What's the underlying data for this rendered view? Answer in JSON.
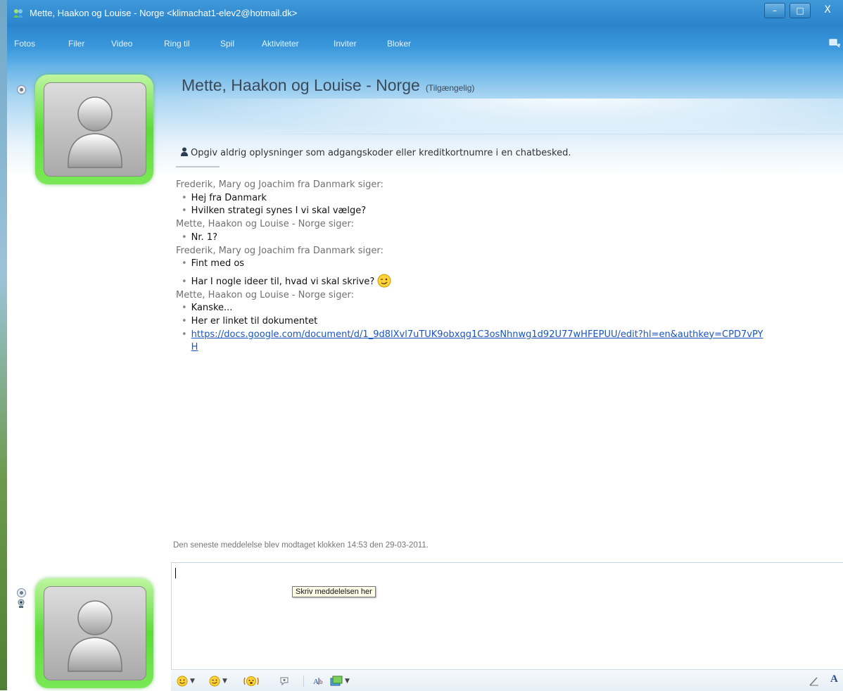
{
  "window": {
    "title": "Mette, Haakon og Louise - Norge <klimachat1-elev2@hotmail.dk>",
    "controls": {
      "minimize": "–",
      "maximize": "□",
      "close": "X"
    }
  },
  "menu": {
    "items": [
      "Fotos",
      "Filer",
      "Video",
      "Ring til",
      "Spil",
      "Aktiviteter",
      "Inviter",
      "Bloker"
    ]
  },
  "contact": {
    "name": "Mette, Haakon og Louise - Norge",
    "status": "(Tilgængelig)"
  },
  "warning": {
    "text": "Opgiv aldrig oplysninger som adgangskoder eller kreditkortnumre i en chatbesked."
  },
  "conversation": [
    {
      "sender": "Frederik, Mary og Joachim fra Danmark siger:",
      "messages": [
        "Hej fra Danmark",
        "Hvilken strategi synes I vi skal vælge?"
      ]
    },
    {
      "sender": "Mette, Haakon og Louise - Norge siger:",
      "messages": [
        "Nr. 1?"
      ]
    },
    {
      "sender": "Frederik, Mary og Joachim fra Danmark siger:",
      "messages": [
        "Fint med os",
        "Har I nogle ideer til, hvad vi skal skrive?"
      ]
    },
    {
      "sender": "Mette, Haakon og Louise - Norge siger:",
      "messages": [
        "Kanske...",
        "Her er  linket til dokumentet",
        "https://docs.google.com/document/d/1_9d8lXvl7uTUK9obxqg1C3osNhnwg1d92U77wHFEPUU/edit?hl=en&authkey=CPD7vPYH"
      ]
    }
  ],
  "status": {
    "last_message": "Den seneste meddelelse blev modtaget klokken 14:53 den 29-03-2011."
  },
  "input": {
    "value": "",
    "tooltip": "Skriv meddelelsen her"
  },
  "toolbar": {
    "font_label": "A"
  },
  "colors": {
    "titlebar": "#2a84cc",
    "link": "#1a55c0",
    "avatar_frame": "#5ddc3a"
  }
}
